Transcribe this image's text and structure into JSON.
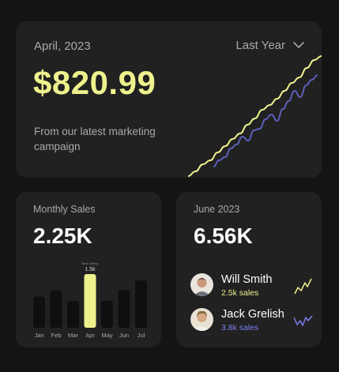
{
  "colors": {
    "accent_yellow": "#eef28d",
    "accent_blue": "#5d5fb8",
    "card_bg": "#212121",
    "page_bg": "#141414",
    "muted_text": "#a9a9a9"
  },
  "main_card": {
    "date": "April, 2023",
    "period": "Last Year",
    "amount": "$820.99",
    "description": "From our latest marketing campaign",
    "chart_data": {
      "type": "line",
      "series": [
        {
          "values": [
            0,
            6,
            15,
            20,
            30,
            38,
            47,
            54,
            65,
            73,
            84,
            90,
            98,
            108,
            118,
            125,
            137,
            147,
            152
          ]
        },
        {
          "values": [
            12,
            20,
            24,
            35,
            40,
            50,
            45,
            58,
            60,
            72,
            78,
            70,
            85,
            95,
            108,
            100,
            115,
            122,
            128
          ]
        }
      ],
      "series_colors": [
        "#eef28d",
        "#5d5fb8"
      ]
    }
  },
  "monthly_card": {
    "title": "Monthly Sales",
    "value": "2.25K",
    "tooltip_caption": "Best Selling",
    "tooltip_value": "1.5k",
    "chart_data": {
      "type": "bar",
      "categories": [
        "Jan",
        "Feb",
        "Mar",
        "Apr",
        "May",
        "Jun",
        "Jul"
      ],
      "values": [
        0.58,
        0.7,
        0.5,
        1.0,
        0.5,
        0.7,
        0.88
      ],
      "highlight_index": 3
    }
  },
  "june_card": {
    "title": "June 2023",
    "value": "6.56K",
    "people": [
      {
        "name": "Will Smith",
        "sales": "2.5k sales",
        "sales_color": "#eef28d",
        "spark_color": "#eef28d"
      },
      {
        "name": "Jack Grelish",
        "sales": "3.8k sales",
        "sales_color": "#7b7ef2",
        "spark_color": "#7b7ef2"
      }
    ]
  }
}
